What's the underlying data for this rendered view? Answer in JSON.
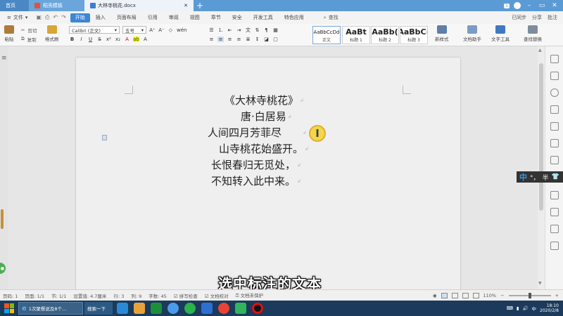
{
  "tabs": [
    {
      "label": "首页"
    },
    {
      "label": "稻壳模板"
    },
    {
      "label": "大林寺桃花.docx"
    }
  ],
  "titlebar": {
    "badge": "1",
    "add": "+"
  },
  "menu": {
    "file": "文件",
    "items": [
      "开始",
      "插入",
      "页面布局",
      "引用",
      "审阅",
      "视图",
      "章节",
      "安全",
      "开发工具",
      "特色应用"
    ],
    "active": "开始",
    "search": "查找",
    "right": [
      "已同步",
      "分享",
      "批注"
    ]
  },
  "ribbon": {
    "paste": "粘贴",
    "cut": "剪切",
    "copy": "复制",
    "format_painter": "格式刷",
    "font_name": "Calibri (正文)",
    "font_size": "五号",
    "bold": "B",
    "italic": "I",
    "underline": "U",
    "styles": [
      {
        "preview": "AaBbCcDd",
        "label": "正文"
      },
      {
        "preview": "AaBt",
        "label": "标题 1"
      },
      {
        "preview": "AaBb(",
        "label": "标题 2"
      },
      {
        "preview": "AaBbC(",
        "label": "标题 3"
      }
    ],
    "new_style": "新样式",
    "doc_helper": "文档助手",
    "text_tools": "文字工具",
    "find_replace": "查找替换"
  },
  "poem": [
    "《大林寺桃花》",
    "唐·白居易",
    "人间四月芳菲尽",
    "山寺桃花始盛开。",
    "长恨春归无觅处，",
    "不知转入此中来。"
  ],
  "cursor_glyph": "I",
  "caption": "选中标注的文本",
  "ime": {
    "mode": "中",
    "punct": "°，",
    "width": "半"
  },
  "status": {
    "page_num": "页码: 1",
    "page": "页面: 1/1",
    "section": "节: 1/1",
    "setting": "设置值: 4.7厘米",
    "row": "行: 3",
    "col": "列: 9",
    "words": "字数: 45",
    "spell": "拼写检查",
    "compare": "文档校对",
    "protect": "文档未保护",
    "zoom": "110%"
  },
  "taskbar": {
    "ie_label": "1次聚餐说及8个...",
    "search_label": "搜索一下",
    "date": "2020/2/8",
    "time": "18:10",
    "lang": "中"
  },
  "colors": {
    "titlebar": "#5b9bd5",
    "active_tab": "#3b87d6",
    "highlight": "#f2d32d",
    "taskbar": "#1b3a5c"
  }
}
